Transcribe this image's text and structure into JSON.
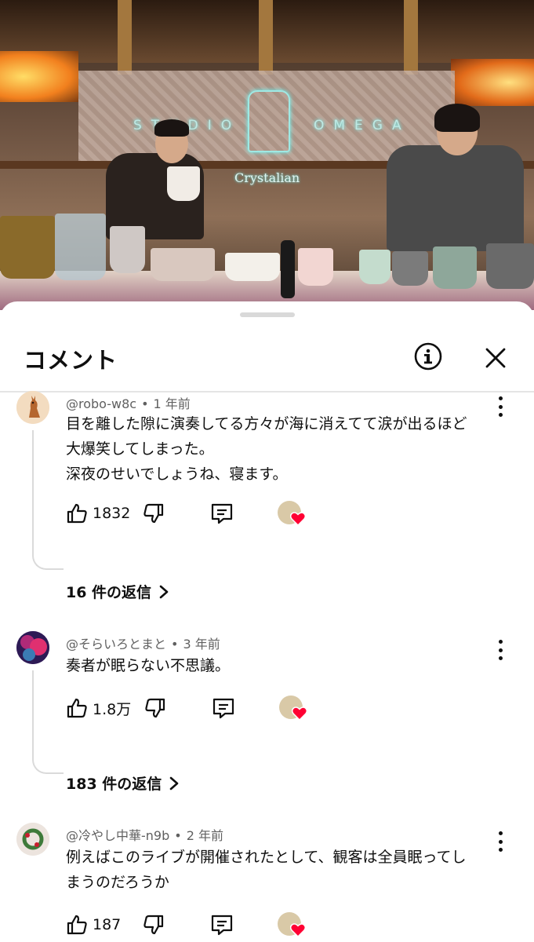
{
  "video": {
    "logo_left": "STUDIO",
    "logo_right": "OMEGA",
    "logo_sub": "Crystalian"
  },
  "sheet": {
    "title": "コメント",
    "info_icon": "info-icon",
    "close_icon": "close-icon"
  },
  "comments": [
    {
      "author": "@robo-w8c",
      "separator": "•",
      "age": "1 年前",
      "lines": [
        "目を離した隙に演奏してる方々が海に消えてて涙が出るほど",
        "大爆笑してしまった。",
        "深夜のせいでしょうね、寝ます。"
      ],
      "likes": "1832",
      "replies": "16 件の返信",
      "avatar_color": "#e8b98a"
    },
    {
      "author": "@そらいろとまと",
      "separator": "•",
      "age": "3 年前",
      "lines": [
        "奏者が眠らない不思議。"
      ],
      "likes": "1.8万",
      "replies": "183 件の返信",
      "avatar_color": "#5a2a7a"
    },
    {
      "author": "@冷やし中華-n9b",
      "separator": "•",
      "age": "2 年前",
      "lines": [
        "例えばこのライブが開催されたとして、観客は全員眠ってし",
        "まうのだろうか"
      ],
      "likes": "187",
      "avatar_color": "#e9e2dc"
    }
  ],
  "colors": {
    "heart": "#ff0033",
    "text": "#0f0f0f",
    "meta": "#606060"
  }
}
